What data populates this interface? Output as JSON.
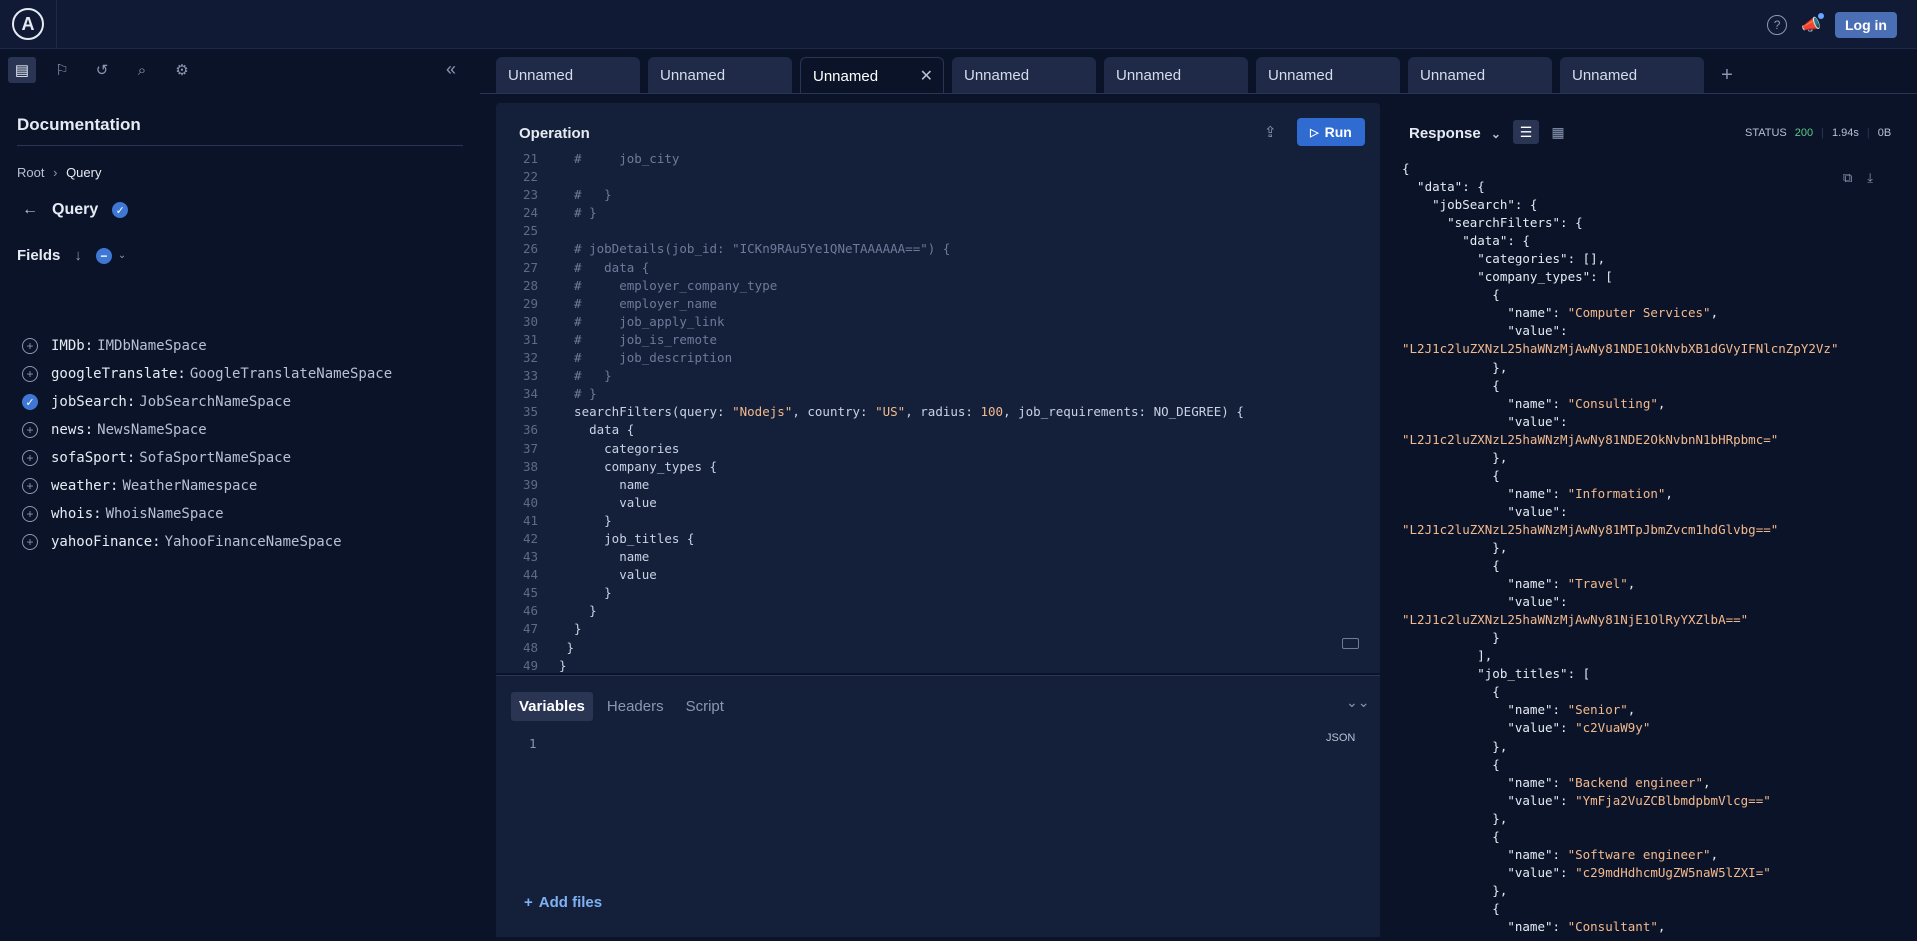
{
  "topbar": {
    "logo": "A",
    "help_icon": "?",
    "login_label": "Log in"
  },
  "sidebar": {
    "doc_title": "Documentation",
    "breadcrumb": {
      "root": "Root",
      "current": "Query"
    },
    "query_label": "Query",
    "fields_label": "Fields",
    "fields": [
      {
        "name": "IMDb:",
        "type": "IMDbNameSpace",
        "checked": false
      },
      {
        "name": "googleTranslate:",
        "type": "GoogleTranslateNameSpace",
        "checked": false
      },
      {
        "name": "jobSearch:",
        "type": "JobSearchNameSpace",
        "checked": true
      },
      {
        "name": "news:",
        "type": "NewsNameSpace",
        "checked": false
      },
      {
        "name": "sofaSport:",
        "type": "SofaSportNameSpace",
        "checked": false
      },
      {
        "name": "weather:",
        "type": "WeatherNamespace",
        "checked": false
      },
      {
        "name": "whois:",
        "type": "WhoisNameSpace",
        "checked": false
      },
      {
        "name": "yahooFinance:",
        "type": "YahooFinanceNameSpace",
        "checked": false
      }
    ]
  },
  "tabs": [
    {
      "label": "Unnamed",
      "active": false
    },
    {
      "label": "Unnamed",
      "active": false
    },
    {
      "label": "Unnamed",
      "active": true
    },
    {
      "label": "Unnamed",
      "active": false
    },
    {
      "label": "Unnamed",
      "active": false
    },
    {
      "label": "Unnamed",
      "active": false
    },
    {
      "label": "Unnamed",
      "active": false
    },
    {
      "label": "Unnamed",
      "active": false
    }
  ],
  "operation": {
    "title": "Operation",
    "run_label": "Run",
    "code_lines": [
      {
        "n": "21",
        "text": "  #     job_city"
      },
      {
        "n": "22",
        "text": ""
      },
      {
        "n": "23",
        "text": "  #   }"
      },
      {
        "n": "24",
        "text": "  # }"
      },
      {
        "n": "25",
        "text": ""
      },
      {
        "n": "26",
        "text": "  # jobDetails(job_id: \"ICKn9RAu5Ye1QNeTAAAAAA==\") {"
      },
      {
        "n": "27",
        "text": "  #   data {"
      },
      {
        "n": "28",
        "text": "  #     employer_company_type"
      },
      {
        "n": "29",
        "text": "  #     employer_name"
      },
      {
        "n": "30",
        "text": "  #     job_apply_link"
      },
      {
        "n": "31",
        "text": "  #     job_is_remote"
      },
      {
        "n": "32",
        "text": "  #     job_description"
      },
      {
        "n": "33",
        "text": "  #   }"
      },
      {
        "n": "34",
        "text": "  # }"
      },
      {
        "n": "35",
        "text": "  searchFilters(query: \"Nodejs\", country: \"US\", radius: 100, job_requirements: NO_DEGREE) {"
      },
      {
        "n": "36",
        "text": "    data {"
      },
      {
        "n": "37",
        "text": "      categories"
      },
      {
        "n": "38",
        "text": "      company_types {"
      },
      {
        "n": "39",
        "text": "        name"
      },
      {
        "n": "40",
        "text": "        value"
      },
      {
        "n": "41",
        "text": "      }"
      },
      {
        "n": "42",
        "text": "      job_titles {"
      },
      {
        "n": "43",
        "text": "        name"
      },
      {
        "n": "44",
        "text": "        value"
      },
      {
        "n": "45",
        "text": "      }"
      },
      {
        "n": "46",
        "text": "    }"
      },
      {
        "n": "47",
        "text": "  }"
      },
      {
        "n": "48",
        "text": " }"
      },
      {
        "n": "49",
        "text": "}"
      }
    ]
  },
  "variables": {
    "tabs": [
      "Variables",
      "Headers",
      "Script"
    ],
    "line_number": "1",
    "format_label": "JSON",
    "add_files_label": "Add files"
  },
  "response": {
    "title": "Response",
    "status_label": "STATUS",
    "status_code": "200",
    "time": "1.94s",
    "size": "0B",
    "json_lines": [
      "{",
      "  \"data\": {",
      "    \"jobSearch\": {",
      "      \"searchFilters\": {",
      "        \"data\": {",
      "          \"categories\": [],",
      "          \"company_types\": [",
      "            {",
      "              \"name\": \"Computer Services\",",
      "              \"value\":",
      "\"L2J1c2luZXNzL25haWNzMjAwNy81NDE1OkNvbXB1dGVyIFNlcnZpY2Vz\"",
      "            },",
      "            {",
      "              \"name\": \"Consulting\",",
      "              \"value\":",
      "\"L2J1c2luZXNzL25haWNzMjAwNy81NDE2OkNvbnN1bHRpbmc=\"",
      "            },",
      "            {",
      "              \"name\": \"Information\",",
      "              \"value\":",
      "\"L2J1c2luZXNzL25haWNzMjAwNy81MTpJbmZvcm1hdGlvbg==\"",
      "            },",
      "            {",
      "              \"name\": \"Travel\",",
      "              \"value\":",
      "\"L2J1c2luZXNzL25haWNzMjAwNy81NjE1OlRyYXZlbA==\"",
      "            }",
      "          ],",
      "          \"job_titles\": [",
      "            {",
      "              \"name\": \"Senior\",",
      "              \"value\": \"c2VuaW9y\"",
      "            },",
      "            {",
      "              \"name\": \"Backend engineer\",",
      "              \"value\": \"YmFja2VuZCBlbmdpbmVlcg==\"",
      "            },",
      "            {",
      "              \"name\": \"Software engineer\",",
      "              \"value\": \"c29mdHdhcmUgZW5naW5lZXI=\"",
      "            },",
      "            {",
      "              \"name\": \"Consultant\","
    ]
  }
}
